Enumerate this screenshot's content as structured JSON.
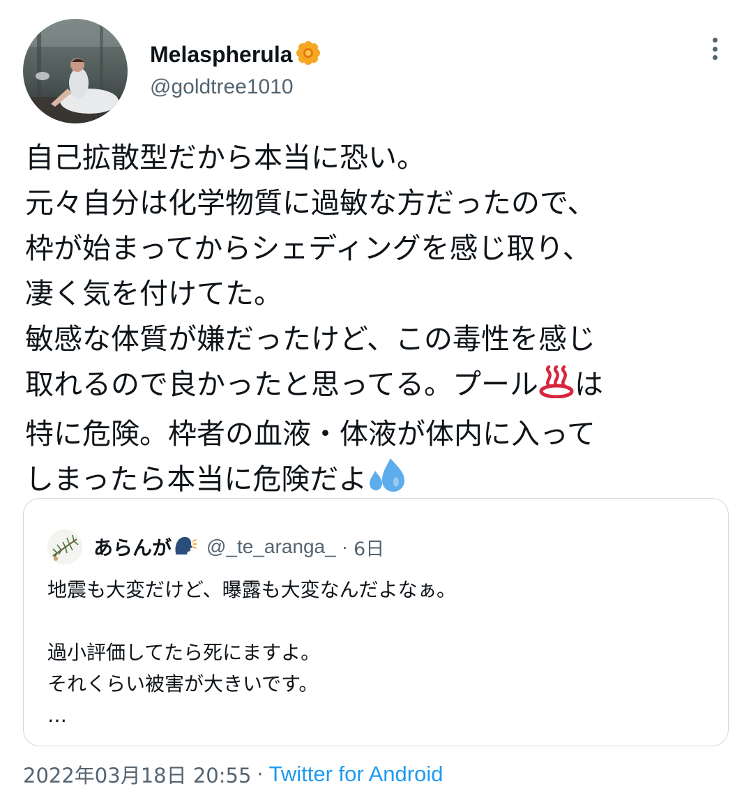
{
  "author": {
    "display_name": "Melaspherula",
    "handle": "@goldtree1010",
    "badge_icon": "orange-flower-emoji",
    "avatar_icon": "ballet-dancer-photo"
  },
  "tweet": {
    "lines": [
      "自己拡散型だから本当に恐い。",
      "元々自分は化学物質に過敏な方だったので、",
      "枠が始まってからシェディングを感じ取り、",
      "凄く気を付けてた。",
      "敏感な体質が嫌だったけど、この毒性を感じ",
      "取れるので良かったと思ってる。プール",
      "は",
      "特に危険。枠者の血液・体液が体内に入って",
      "しまったら本当に危険だよ"
    ],
    "emojis": [
      "hot-springs-emoji",
      "sweat-droplets-emoji"
    ]
  },
  "quoted": {
    "display_name": "あらんが",
    "name_emoji": "speaking-head-emoji",
    "handle": "@_te_aranga_",
    "separator": "·",
    "time": "6日",
    "lines": [
      "地震も大変だけど、曝露も大変なんだよなぁ。",
      "",
      "過小評価してたら死にますよ。",
      "それくらい被害が大きいです。",
      "…"
    ]
  },
  "footer": {
    "timestamp": "2022年03月18日 20:55",
    "separator": "·",
    "source": "Twitter for Android"
  },
  "colors": {
    "text": "#0f1419",
    "secondary": "#536471",
    "link": "#1d9bf0",
    "border": "#cfd9de"
  }
}
